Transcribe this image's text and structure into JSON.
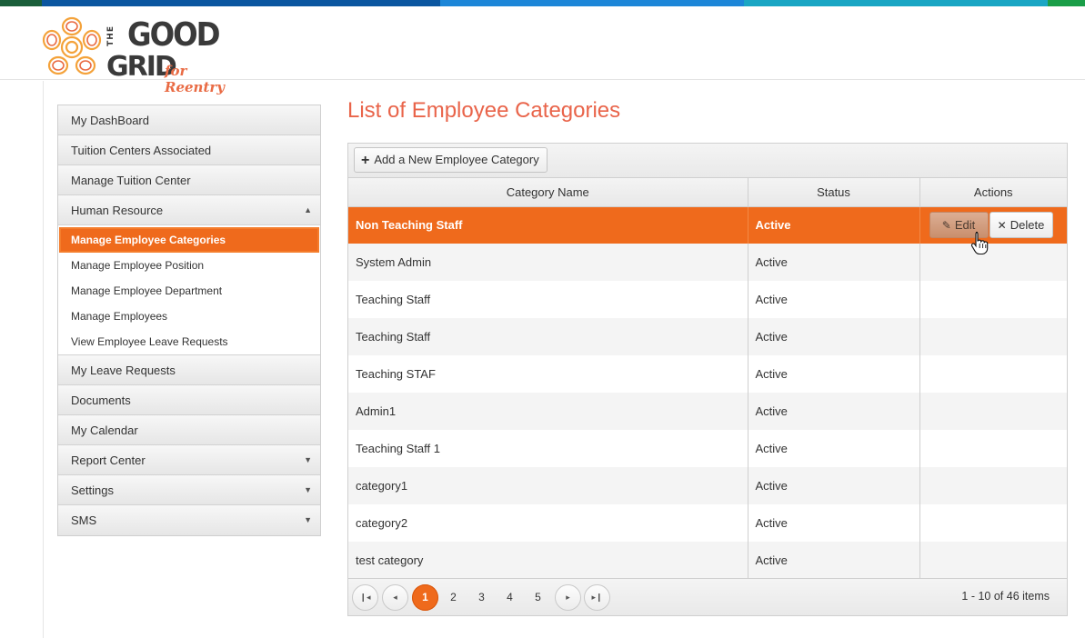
{
  "brand": {
    "the": "THE",
    "good": "GOOD",
    "grid": "GRID",
    "tagline": "for Reentry",
    "colors": [
      "#f4a23a",
      "#e96b44"
    ]
  },
  "topbar_colors": [
    "#1a6b3a",
    "#0b5aa3",
    "#1b86d9",
    "#1aa3c6",
    "#1a9e4b"
  ],
  "sidebar": {
    "items": [
      {
        "label": "My DashBoard"
      },
      {
        "label": "Tuition Centers Associated"
      },
      {
        "label": "Manage Tuition Center"
      },
      {
        "label": "Human Resource",
        "caret": "▲"
      }
    ],
    "sub_items": [
      {
        "label": "Manage Employee Categories"
      },
      {
        "label": "Manage Employee Position"
      },
      {
        "label": "Manage Employee Department"
      },
      {
        "label": "Manage Employees"
      },
      {
        "label": "View Employee Leave Requests"
      }
    ],
    "items_after": [
      {
        "label": "My Leave Requests"
      },
      {
        "label": "Documents"
      },
      {
        "label": "My Calendar"
      },
      {
        "label": "Report Center",
        "caret": "▼"
      },
      {
        "label": "Settings",
        "caret": "▼"
      },
      {
        "label": "SMS",
        "caret": "▼"
      }
    ]
  },
  "main": {
    "title": "List of Employee Categories",
    "add_button": "Add a New Employee Category",
    "columns": [
      "Category Name",
      "Status",
      "Actions"
    ],
    "rows": [
      {
        "name": "Non Teaching Staff",
        "status": "Active"
      },
      {
        "name": "System Admin",
        "status": "Active"
      },
      {
        "name": "Teaching Staff",
        "status": "Active"
      },
      {
        "name": "Teaching Staff",
        "status": "Active"
      },
      {
        "name": "Teaching STAF",
        "status": "Active"
      },
      {
        "name": "Admin1",
        "status": "Active"
      },
      {
        "name": "Teaching Staff 1",
        "status": "Active"
      },
      {
        "name": "category1",
        "status": "Active"
      },
      {
        "name": "category2",
        "status": "Active"
      },
      {
        "name": "test category",
        "status": "Active"
      }
    ],
    "edit_label": "Edit",
    "delete_label": "Delete",
    "pager": {
      "first": "⏮",
      "prev": "◀",
      "pages": [
        "1",
        "2",
        "3",
        "4",
        "5"
      ],
      "current": "1",
      "next": "▶",
      "last": "⏭",
      "info": "1 - 10 of 46 items"
    }
  },
  "accent_color": "#ef6a1c"
}
